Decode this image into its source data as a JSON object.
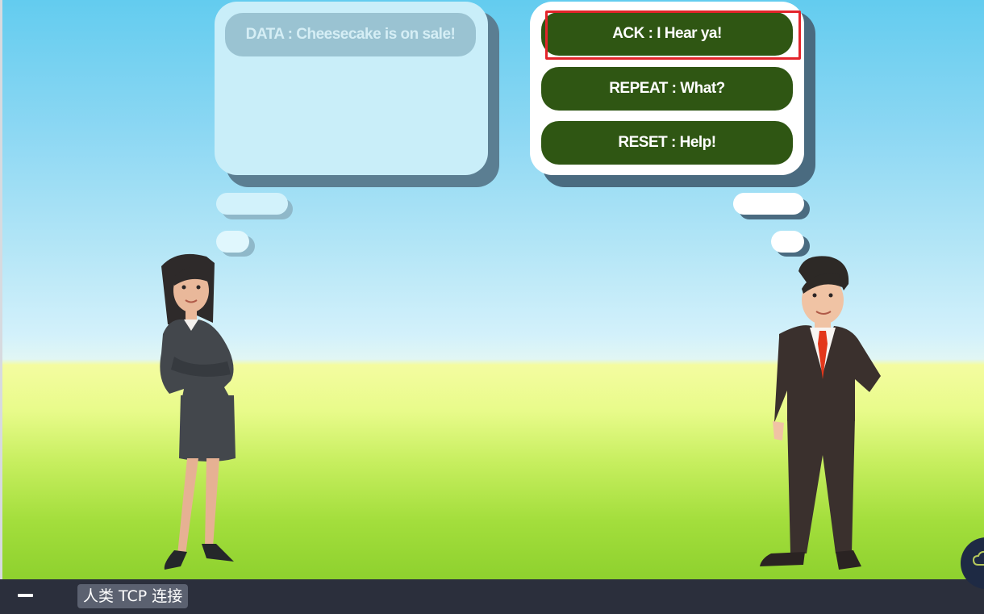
{
  "left_bubble": {
    "data_message": "DATA : Cheesecake is on sale!"
  },
  "right_bubble": {
    "choices": [
      {
        "label": "ACK : I Hear ya!",
        "highlighted": true
      },
      {
        "label": "REPEAT : What?"
      },
      {
        "label": "RESET : Help!"
      }
    ]
  },
  "taskbar": {
    "label": "人类 TCP 连接"
  },
  "colors": {
    "choice_button": "#2f5613",
    "highlight_border": "#e3242b",
    "data_pill": "#9ac3d2"
  },
  "icons": {
    "minimize": "minimize-icon",
    "cloud": "cloud-icon"
  }
}
